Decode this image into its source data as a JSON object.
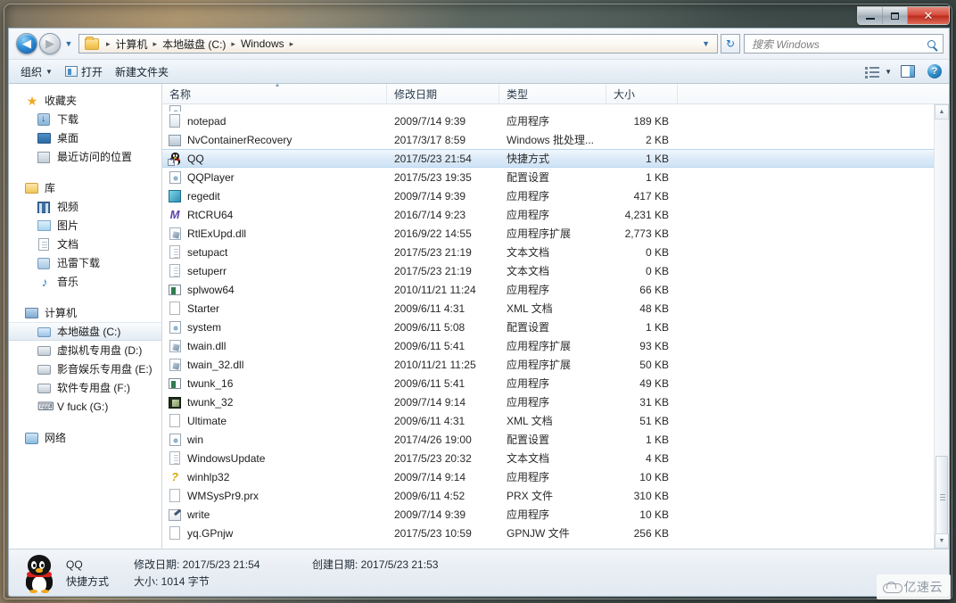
{
  "window": {
    "controls": {
      "minimize": "最小化",
      "maximize": "最大化",
      "close": "关闭"
    }
  },
  "addressbar": {
    "back_tooltip": "后退",
    "forward_tooltip": "前进",
    "folder_icon": "folder-icon",
    "breadcrumbs": [
      "计算机",
      "本地磁盘 (C:)",
      "Windows"
    ],
    "separator": "▸",
    "dropdown": "▼",
    "refresh": "↻",
    "search_placeholder": "搜索 Windows"
  },
  "toolbar": {
    "organize_label": "组织",
    "organize_caret": "▼",
    "open_label": "打开",
    "newfolder_label": "新建文件夹",
    "views_caret": "▼",
    "help_glyph": "?"
  },
  "navpane": {
    "groups": [
      {
        "header": {
          "label": "收藏夹",
          "icon": "star-icon"
        },
        "items": [
          {
            "label": "下载",
            "icon": "downloads-icon"
          },
          {
            "label": "桌面",
            "icon": "desktop-icon"
          },
          {
            "label": "最近访问的位置",
            "icon": "recent-places-icon"
          }
        ]
      },
      {
        "header": {
          "label": "库",
          "icon": "library-icon"
        },
        "items": [
          {
            "label": "视频",
            "icon": "video-icon"
          },
          {
            "label": "图片",
            "icon": "pictures-icon"
          },
          {
            "label": "文档",
            "icon": "documents-icon"
          },
          {
            "label": "迅雷下载",
            "icon": "thunder-download-icon"
          },
          {
            "label": "音乐",
            "icon": "music-icon"
          }
        ]
      },
      {
        "header": {
          "label": "计算机",
          "icon": "computer-icon"
        },
        "items": [
          {
            "label": "本地磁盘 (C:)",
            "icon": "system-drive-icon",
            "selected": true
          },
          {
            "label": "虚拟机专用盘 (D:)",
            "icon": "drive-icon"
          },
          {
            "label": "影音娱乐专用盘 (E:)",
            "icon": "drive-icon"
          },
          {
            "label": "软件专用盘 (F:)",
            "icon": "drive-icon"
          },
          {
            "label": "V fuck (G:)",
            "icon": "removable-drive-icon"
          }
        ]
      },
      {
        "header": {
          "label": "网络",
          "icon": "network-icon"
        },
        "items": []
      }
    ]
  },
  "filelist": {
    "columns": [
      {
        "key": "name",
        "label": "名称",
        "sorted": true
      },
      {
        "key": "date",
        "label": "修改日期"
      },
      {
        "key": "type",
        "label": "类型"
      },
      {
        "key": "size",
        "label": "大小"
      }
    ],
    "rows": [
      {
        "name": "",
        "date": "",
        "type": "",
        "size": "",
        "icon": "file-icon",
        "clipped": true
      },
      {
        "name": "notepad",
        "date": "2009/7/14 9:39",
        "type": "应用程序",
        "size": "189 KB",
        "icon": "notepad-icon"
      },
      {
        "name": "NvContainerRecovery",
        "date": "2017/3/17 8:59",
        "type": "Windows 批处理...",
        "size": "2 KB",
        "icon": "batch-file-icon"
      },
      {
        "name": "QQ",
        "date": "2017/5/23 21:54",
        "type": "快捷方式",
        "size": "1 KB",
        "icon": "qq-shortcut-icon",
        "selected": true
      },
      {
        "name": "QQPlayer",
        "date": "2017/5/23 19:35",
        "type": "配置设置",
        "size": "1 KB",
        "icon": "config-icon"
      },
      {
        "name": "regedit",
        "date": "2009/7/14 9:39",
        "type": "应用程序",
        "size": "417 KB",
        "icon": "regedit-icon"
      },
      {
        "name": "RtCRU64",
        "date": "2016/7/14 9:23",
        "type": "应用程序",
        "size": "4,231 KB",
        "icon": "realtek-icon"
      },
      {
        "name": "RtlExUpd.dll",
        "date": "2016/9/22 14:55",
        "type": "应用程序扩展",
        "size": "2,773 KB",
        "icon": "dll-icon"
      },
      {
        "name": "setupact",
        "date": "2017/5/23 21:19",
        "type": "文本文档",
        "size": "0 KB",
        "icon": "text-file-icon"
      },
      {
        "name": "setuperr",
        "date": "2017/5/23 21:19",
        "type": "文本文档",
        "size": "0 KB",
        "icon": "text-file-icon"
      },
      {
        "name": "splwow64",
        "date": "2010/11/21 11:24",
        "type": "应用程序",
        "size": "66 KB",
        "icon": "splwow-icon"
      },
      {
        "name": "Starter",
        "date": "2009/6/11 4:31",
        "type": "XML 文档",
        "size": "48 KB",
        "icon": "xml-file-icon"
      },
      {
        "name": "system",
        "date": "2009/6/11 5:08",
        "type": "配置设置",
        "size": "1 KB",
        "icon": "config-icon"
      },
      {
        "name": "twain.dll",
        "date": "2009/6/11 5:41",
        "type": "应用程序扩展",
        "size": "93 KB",
        "icon": "dll-icon"
      },
      {
        "name": "twain_32.dll",
        "date": "2010/11/21 11:25",
        "type": "应用程序扩展",
        "size": "50 KB",
        "icon": "dll-icon"
      },
      {
        "name": "twunk_16",
        "date": "2009/6/11 5:41",
        "type": "应用程序",
        "size": "49 KB",
        "icon": "splwow-icon"
      },
      {
        "name": "twunk_32",
        "date": "2009/7/14 9:14",
        "type": "应用程序",
        "size": "31 KB",
        "icon": "twunk-icon"
      },
      {
        "name": "Ultimate",
        "date": "2009/6/11 4:31",
        "type": "XML 文档",
        "size": "51 KB",
        "icon": "xml-file-icon"
      },
      {
        "name": "win",
        "date": "2017/4/26 19:00",
        "type": "配置设置",
        "size": "1 KB",
        "icon": "config-icon"
      },
      {
        "name": "WindowsUpdate",
        "date": "2017/5/23 20:32",
        "type": "文本文档",
        "size": "4 KB",
        "icon": "text-file-icon"
      },
      {
        "name": "winhlp32",
        "date": "2009/7/14 9:14",
        "type": "应用程序",
        "size": "10 KB",
        "icon": "help-app-icon"
      },
      {
        "name": "WMSysPr9.prx",
        "date": "2009/6/11 4:52",
        "type": "PRX 文件",
        "size": "310 KB",
        "icon": "prx-file-icon"
      },
      {
        "name": "write",
        "date": "2009/7/14 9:39",
        "type": "应用程序",
        "size": "10 KB",
        "icon": "write-icon"
      },
      {
        "name": "yq.GPnjw",
        "date": "2017/5/23 10:59",
        "type": "GPNJW 文件",
        "size": "256 KB",
        "icon": "generic-file-icon"
      }
    ]
  },
  "scrollbar": {
    "up": "▲",
    "down": "▼"
  },
  "statusbar": {
    "icon": "qq-penguin-icon",
    "name": "QQ",
    "kind": "快捷方式",
    "modified_label": "修改日期: 2017/5/23 21:54",
    "created_label": "创建日期: 2017/5/23 21:53",
    "size_label": "大小: 1014 字节"
  },
  "watermark": {
    "text": "亿速云",
    "icon": "cloud-icon"
  }
}
